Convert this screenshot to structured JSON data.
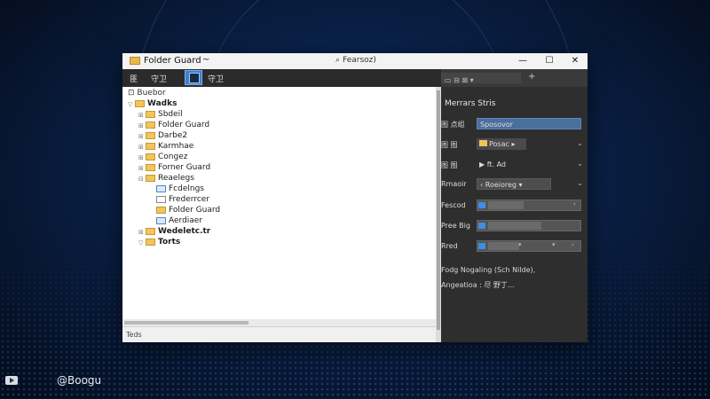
{
  "window": {
    "title": "Folder Guard",
    "title_caret": "~",
    "search_text": "Fearsoz)",
    "search_icon": "magnifier-icon",
    "controls": {
      "minimize": "—",
      "maximize": "☐",
      "close": "✕"
    }
  },
  "toolbar": {
    "items": [
      {
        "label": "匪"
      },
      {
        "label": "守卫"
      }
    ],
    "active_item_icon": "folder-guard-icon",
    "active_item_label": "守卫"
  },
  "tree": {
    "header": "Buebor",
    "rows": [
      {
        "label": "Wadks",
        "expander": "▽",
        "bold": true
      },
      {
        "label": "Sbdeil",
        "expander": "⊞"
      },
      {
        "label": "Folder Guard",
        "expander": "⊞"
      },
      {
        "label": "Darbe2",
        "expander": "⊞"
      },
      {
        "label": "Karmhae",
        "expander": "⊞"
      },
      {
        "label": "Congez",
        "expander": "⊞"
      },
      {
        "label": "Forner Guard",
        "expander": "⊞"
      },
      {
        "label": "Reaelegs",
        "expander": "⊟"
      },
      {
        "label": "Fcdelngs",
        "expander": ""
      },
      {
        "label": "Frederrcer",
        "expander": ""
      },
      {
        "label": "Folder Guard",
        "expander": ""
      },
      {
        "label": "Aerdiaer",
        "expander": ""
      },
      {
        "label": "Wedeletc.tr",
        "expander": "⊞"
      },
      {
        "label": "Torts",
        "expander": "▽"
      }
    ]
  },
  "status": {
    "text": "Teds"
  },
  "right_pane": {
    "title": "Merrars Stris",
    "fields": [
      {
        "label": "图 点组",
        "value": "Sposovor"
      },
      {
        "label": "图 图",
        "value": "Posac"
      },
      {
        "label": "图 图",
        "value": "ft. Ad"
      },
      {
        "label": "Rmaoir",
        "value": "Roeioreg"
      }
    ],
    "sliders": [
      {
        "label": "Fescod",
        "level": 0.4
      },
      {
        "label": "Pree Big",
        "level": 0.6
      },
      {
        "label": "Rred",
        "level": 0.35
      }
    ],
    "notes": [
      "Fodg Nogaling (Sch Nilde),",
      "Angeatioa : 尽 野丁..."
    ]
  },
  "watermark": {
    "text": "@Boogu"
  },
  "colors": {
    "accent": "#3d8fe6",
    "folder": "#f2c45a",
    "dark_panel": "#2e2e2e"
  }
}
